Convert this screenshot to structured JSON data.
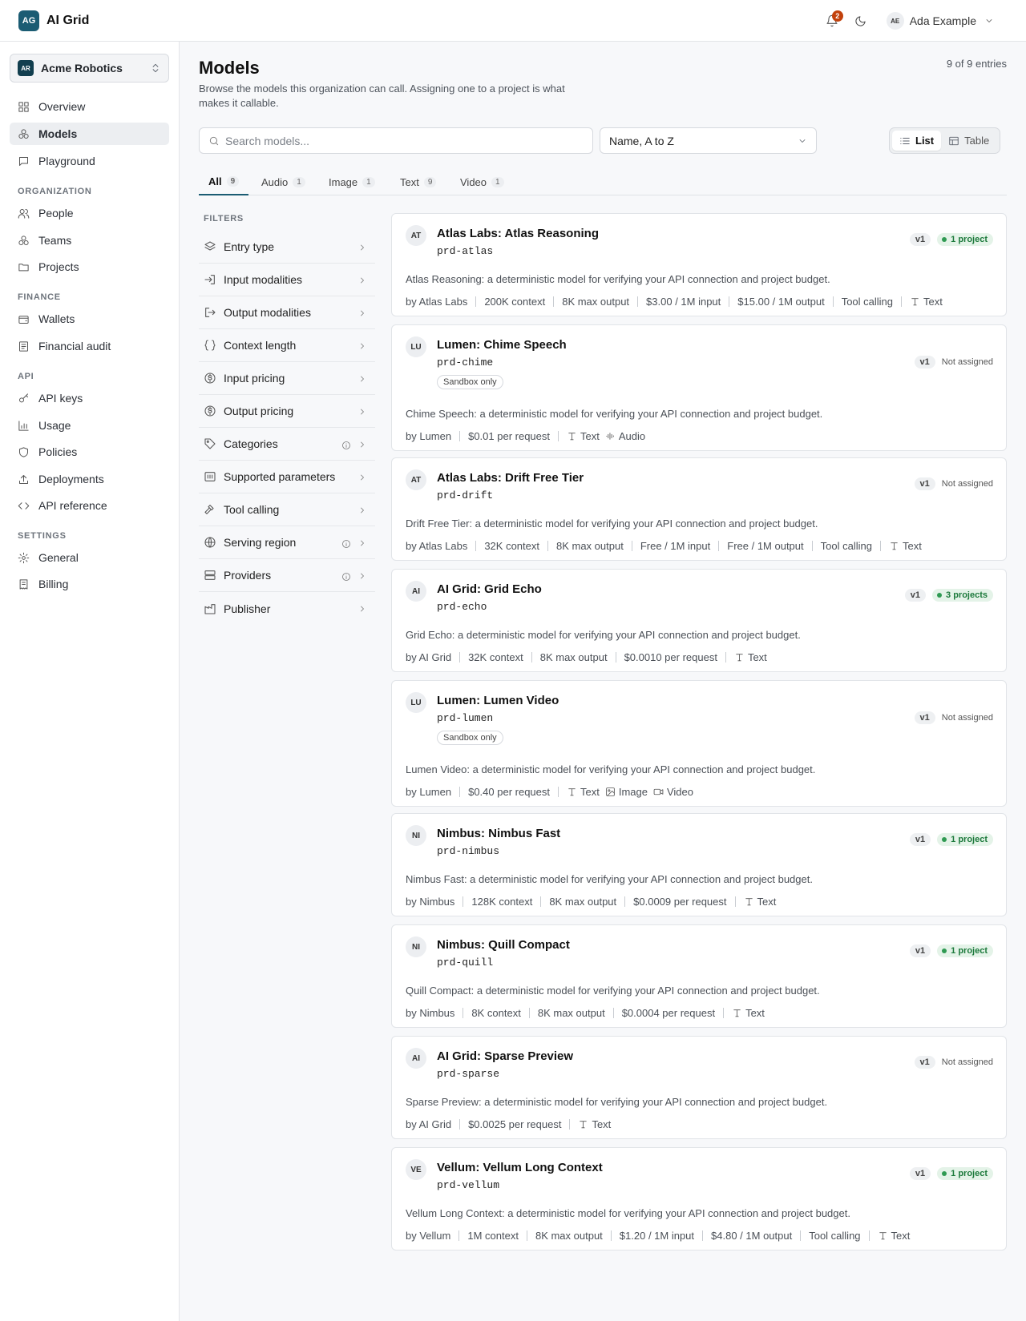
{
  "app": {
    "brand_mark": "AG",
    "brand_name": "AI Grid"
  },
  "topbar": {
    "notification_count": "2",
    "user_initials": "AE",
    "user_name": "Ada Example"
  },
  "org": {
    "initials": "AR",
    "name": "Acme Robotics"
  },
  "sidebar": {
    "items": [
      {
        "label": "Overview",
        "icon": "grid-icon"
      },
      {
        "label": "Models",
        "icon": "cubes-icon"
      },
      {
        "label": "Playground",
        "icon": "chat-icon"
      },
      {
        "label": "People",
        "icon": "users-icon"
      },
      {
        "label": "Teams",
        "icon": "teams-icon"
      },
      {
        "label": "Projects",
        "icon": "folder-icon"
      },
      {
        "label": "Wallets",
        "icon": "wallet-icon"
      },
      {
        "label": "Financial audit",
        "icon": "ledger-icon"
      },
      {
        "label": "API keys",
        "icon": "key-icon"
      },
      {
        "label": "Usage",
        "icon": "chart-icon"
      },
      {
        "label": "Policies",
        "icon": "shield-icon"
      },
      {
        "label": "Deployments",
        "icon": "upload-icon"
      },
      {
        "label": "API reference",
        "icon": "code-icon"
      },
      {
        "label": "General",
        "icon": "gear-icon"
      },
      {
        "label": "Billing",
        "icon": "receipt-icon"
      }
    ],
    "sections": [
      "ORGANIZATION",
      "FINANCE",
      "API",
      "SETTINGS"
    ]
  },
  "page": {
    "title": "Models",
    "description": "Browse the models this organization can call. Assigning one to a project is what makes it callable.",
    "entries": "9 of 9 entries"
  },
  "search": {
    "placeholder": "Search models..."
  },
  "sort": {
    "value": "Name, A to Z"
  },
  "view_toggle": {
    "list": "List",
    "table": "Table"
  },
  "tabs": [
    {
      "label": "All",
      "count": "9"
    },
    {
      "label": "Audio",
      "count": "1"
    },
    {
      "label": "Image",
      "count": "1"
    },
    {
      "label": "Text",
      "count": "9"
    },
    {
      "label": "Video",
      "count": "1"
    }
  ],
  "filters": {
    "heading": "FILTERS",
    "items": [
      {
        "label": "Entry type",
        "icon": "layers-icon"
      },
      {
        "label": "Input modalities",
        "icon": "input-icon"
      },
      {
        "label": "Output modalities",
        "icon": "output-icon"
      },
      {
        "label": "Context length",
        "icon": "braces-icon"
      },
      {
        "label": "Input pricing",
        "icon": "dollar-circle-icon"
      },
      {
        "label": "Output pricing",
        "icon": "dollar-circle-icon"
      },
      {
        "label": "Categories",
        "icon": "tag-icon"
      },
      {
        "label": "Supported parameters",
        "icon": "sliders-icon"
      },
      {
        "label": "Tool calling",
        "icon": "hammer-icon"
      },
      {
        "label": "Serving region",
        "icon": "globe-icon"
      },
      {
        "label": "Providers",
        "icon": "server-icon"
      },
      {
        "label": "Publisher",
        "icon": "building-icon"
      }
    ]
  },
  "models": [
    {
      "avatar": "AT",
      "name": "Atlas Labs: Atlas Reasoning",
      "code": "prd-atlas",
      "sandbox": "",
      "description": "Atlas Reasoning: a deterministic model for verifying your API connection and project budget.",
      "meta": [
        "by Atlas Labs",
        "200K context",
        "8K max output",
        "$3.00 / 1M input",
        "$15.00 / 1M output",
        "Tool calling"
      ],
      "modalities": [
        "Text"
      ],
      "version": "v1",
      "assignment": "1 project",
      "assigned": true
    },
    {
      "avatar": "LU",
      "name": "Lumen: Chime Speech",
      "code": "prd-chime",
      "sandbox": "Sandbox only",
      "description": "Chime Speech: a deterministic model for verifying your API connection and project budget.",
      "meta": [
        "by Lumen",
        "$0.01 per request"
      ],
      "modalities": [
        "Text",
        "Audio"
      ],
      "version": "v1",
      "assignment": "Not assigned",
      "assigned": false
    },
    {
      "avatar": "AT",
      "name": "Atlas Labs: Drift Free Tier",
      "code": "prd-drift",
      "sandbox": "",
      "description": "Drift Free Tier: a deterministic model for verifying your API connection and project budget.",
      "meta": [
        "by Atlas Labs",
        "32K context",
        "8K max output",
        "Free / 1M input",
        "Free / 1M output",
        "Tool calling"
      ],
      "modalities": [
        "Text"
      ],
      "version": "v1",
      "assignment": "Not assigned",
      "assigned": false
    },
    {
      "avatar": "AI",
      "name": "AI Grid: Grid Echo",
      "code": "prd-echo",
      "sandbox": "",
      "description": "Grid Echo: a deterministic model for verifying your API connection and project budget.",
      "meta": [
        "by AI Grid",
        "32K context",
        "8K max output",
        "$0.0010 per request"
      ],
      "modalities": [
        "Text"
      ],
      "version": "v1",
      "assignment": "3 projects",
      "assigned": true
    },
    {
      "avatar": "LU",
      "name": "Lumen: Lumen Video",
      "code": "prd-lumen",
      "sandbox": "Sandbox only",
      "description": "Lumen Video: a deterministic model for verifying your API connection and project budget.",
      "meta": [
        "by Lumen",
        "$0.40 per request"
      ],
      "modalities": [
        "Text",
        "Image",
        "Video"
      ],
      "version": "v1",
      "assignment": "Not assigned",
      "assigned": false
    },
    {
      "avatar": "NI",
      "name": "Nimbus: Nimbus Fast",
      "code": "prd-nimbus",
      "sandbox": "",
      "description": "Nimbus Fast: a deterministic model for verifying your API connection and project budget.",
      "meta": [
        "by Nimbus",
        "128K context",
        "8K max output",
        "$0.0009 per request"
      ],
      "modalities": [
        "Text"
      ],
      "version": "v1",
      "assignment": "1 project",
      "assigned": true
    },
    {
      "avatar": "NI",
      "name": "Nimbus: Quill Compact",
      "code": "prd-quill",
      "sandbox": "",
      "description": "Quill Compact: a deterministic model for verifying your API connection and project budget.",
      "meta": [
        "by Nimbus",
        "8K context",
        "8K max output",
        "$0.0004 per request"
      ],
      "modalities": [
        "Text"
      ],
      "version": "v1",
      "assignment": "1 project",
      "assigned": true
    },
    {
      "avatar": "AI",
      "name": "AI Grid: Sparse Preview",
      "code": "prd-sparse",
      "sandbox": "",
      "description": "Sparse Preview: a deterministic model for verifying your API connection and project budget.",
      "meta": [
        "by AI Grid",
        "$0.0025 per request"
      ],
      "modalities": [
        "Text"
      ],
      "version": "v1",
      "assignment": "Not assigned",
      "assigned": false
    },
    {
      "avatar": "VE",
      "name": "Vellum: Vellum Long Context",
      "code": "prd-vellum",
      "sandbox": "",
      "description": "Vellum Long Context: a deterministic model for verifying your API connection and project budget.",
      "meta": [
        "by Vellum",
        "1M context",
        "8K max output",
        "$1.20 / 1M input",
        "$4.80 / 1M output",
        "Tool calling"
      ],
      "modalities": [
        "Text"
      ],
      "version": "v1",
      "assignment": "1 project",
      "assigned": true
    }
  ]
}
